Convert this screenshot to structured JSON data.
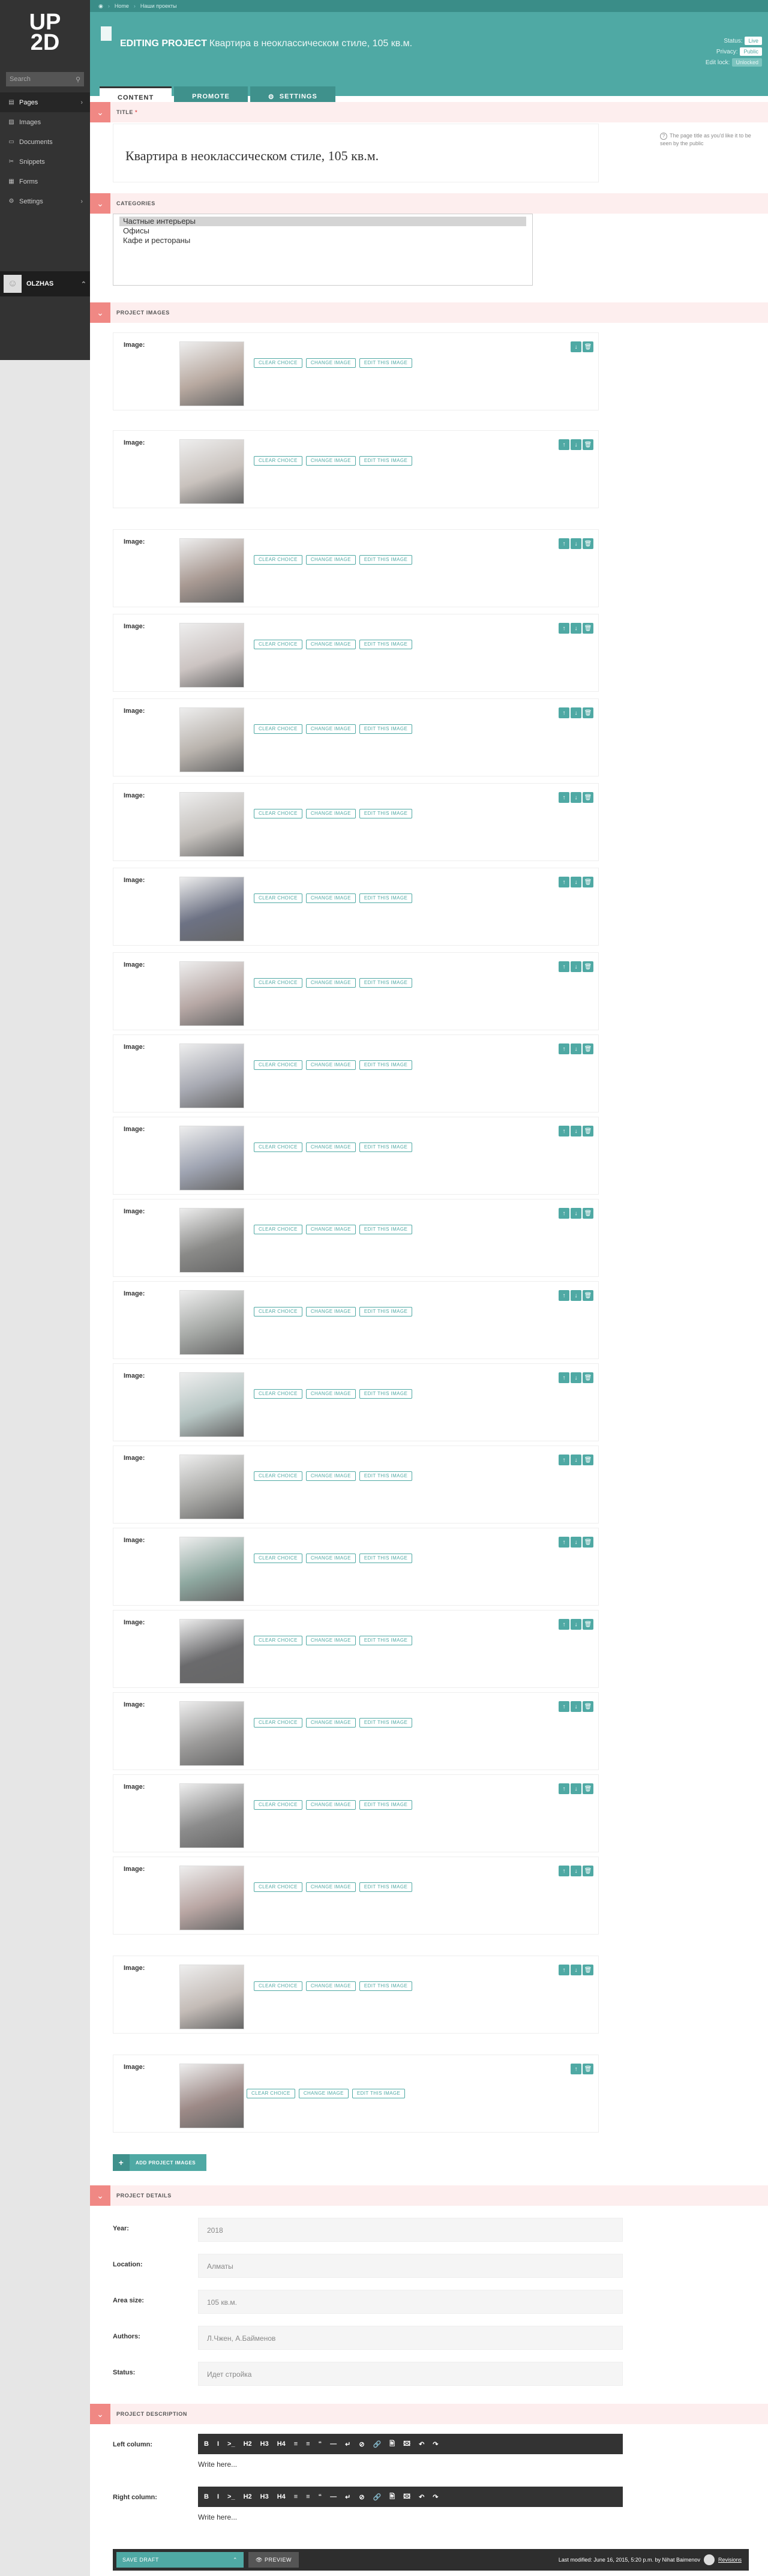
{
  "sidebar": {
    "logo": "UP2D",
    "search_placeholder": "Search",
    "items": [
      {
        "label": "Pages",
        "icon": "pages-icon",
        "active": true
      },
      {
        "label": "Images",
        "icon": "images-icon"
      },
      {
        "label": "Documents",
        "icon": "documents-icon"
      },
      {
        "label": "Snippets",
        "icon": "snippets-icon"
      },
      {
        "label": "Forms",
        "icon": "forms-icon"
      },
      {
        "label": "Settings",
        "icon": "settings-icon"
      }
    ],
    "user": "OLZHAS"
  },
  "breadcrumb": [
    "Home",
    "Наши проекты"
  ],
  "header": {
    "prefix": "EDITING PROJECT",
    "title": "Квартира в неоклассическом стиле, 105 кв.м.",
    "status_label": "Status:",
    "status_value": "Live",
    "privacy_label": "Privacy:",
    "privacy_value": "Public",
    "edit_label": "Edit lock:",
    "edit_value": "Unlocked"
  },
  "tabs": [
    "CONTENT",
    "PROMOTE",
    "SETTINGS"
  ],
  "sections": {
    "title": "TITLE",
    "categories": "CATEGORIES",
    "images": "PROJECT IMAGES",
    "details": "PROJECT DETAILS",
    "description": "PROJECT DESCRIPTION"
  },
  "title_value": "Квартира в неоклассическом стиле, 105 кв.м.",
  "title_help": "The page title as you'd like it to be seen by the public",
  "categories": [
    "Частные интерьеры",
    "Офисы",
    "Кафе и рестораны"
  ],
  "image_label": "Image:",
  "image_buttons": [
    "CLEAR CHOICE",
    "CHANGE IMAGE",
    "EDIT THIS IMAGE"
  ],
  "add_image": "ADD PROJECT IMAGES",
  "details": [
    {
      "label": "Year:",
      "value": "2018"
    },
    {
      "label": "Location:",
      "value": "Алматы"
    },
    {
      "label": "Area size:",
      "value": "105 кв.м."
    },
    {
      "label": "Authors:",
      "value": "Л.Чжен, А.Байменов"
    },
    {
      "label": "Status:",
      "value": "Идет стройка"
    }
  ],
  "description": {
    "left_label": "Left column:",
    "right_label": "Right column:",
    "placeholder": "Write here...",
    "toolbar": [
      "B",
      "I",
      ">_",
      "H2",
      "H3",
      "H4",
      "≡",
      "≡",
      "“",
      "—",
      "↵",
      "⊘",
      "🔗",
      "🖹",
      "🖾",
      "↶",
      "↷"
    ]
  },
  "footer": {
    "save": "SAVE DRAFT",
    "preview": "PREVIEW",
    "last_modified": "Last modified: June 16, 2015, 5:20 p.m. by Nihat Baimenov",
    "revisions": "Revisions"
  }
}
